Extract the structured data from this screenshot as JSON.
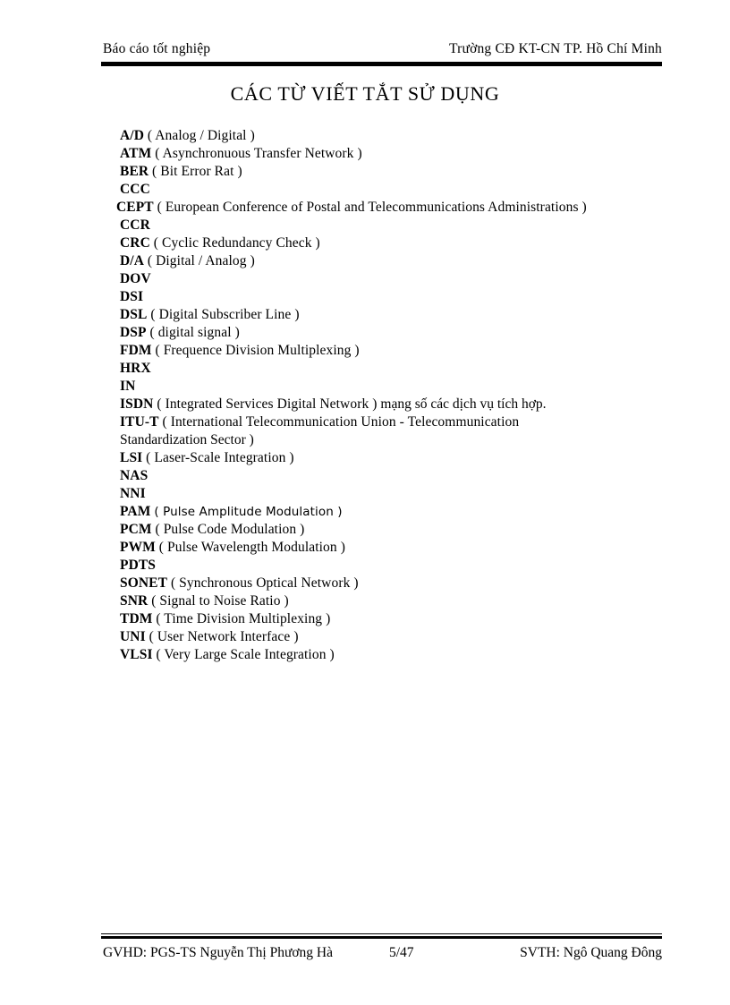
{
  "header": {
    "left": "Báo cáo tốt nghiệp",
    "right": "Trường CĐ KT-CN TP. Hồ Chí Minh"
  },
  "title": "CÁC TỪ VIẾT TẮT SỬ DỤNG",
  "abbreviations": [
    {
      "term": "A/D",
      "definition": "( Analog / Digital )"
    },
    {
      "term": "ATM",
      "definition": "( Asynchronuous  Transfer Network )"
    },
    {
      "term": "BER",
      "definition": "( Bit Error Rat )"
    },
    {
      "term": "CCC",
      "definition": ""
    },
    {
      "term": "CEPT",
      "definition": "( European  Conference of Postal and Telecommunications  Administrations  )"
    },
    {
      "term": "CCR",
      "definition": ""
    },
    {
      "term": "CRC",
      "definition": "( Cyclic Redundancy  Check )"
    },
    {
      "term": "D/A",
      "definition": "( Digital / Analog )"
    },
    {
      "term": "DOV",
      "definition": ""
    },
    {
      "term": "DSI",
      "definition": ""
    },
    {
      "term": "DSL",
      "definition": "( Digital Subscriber Line )"
    },
    {
      "term": "DSP",
      "definition": "( digital signal )"
    },
    {
      "term": "FDM",
      "definition": "( Frequence Division Multiplexing )"
    },
    {
      "term": "HRX",
      "definition": ""
    },
    {
      "term": "IN",
      "definition": ""
    },
    {
      "term": "ISDN",
      "definition": "( Integrated Services Digital Network )",
      "note": "mạng số các dịch vụ tích hợp."
    },
    {
      "term": "ITU-T",
      "definition": "( International Telecommunication Union - Telecommunication",
      "continuation": "Standardization  Sector )"
    },
    {
      "term": "LSI",
      "definition": "( Laser-Scale Integration )"
    },
    {
      "term": "NAS",
      "definition": ""
    },
    {
      "term": "NNI",
      "definition": ""
    },
    {
      "term": "PAM",
      "definition": "( Pulse Amplitude Modulation )",
      "alt_face": true
    },
    {
      "term": "PCM",
      "definition": "( Pulse Code Modulation )"
    },
    {
      "term": "PWM",
      "definition": "( Pulse Wavelength  Modulation )"
    },
    {
      "term": "PDTS",
      "definition": ""
    },
    {
      "term": "SONET",
      "definition": "( Synchronous  Optical Network )"
    },
    {
      "term": "SNR",
      "definition": "( Signal  to Noise Ratio )"
    },
    {
      "term": "TDM",
      "definition": "( Time Division Multiplexing )"
    },
    {
      "term": "UNI",
      "definition": "( User Network Interface )"
    },
    {
      "term": "VLSI",
      "definition": "( Very Large Scale Integration )"
    }
  ],
  "footer": {
    "advisor": "GVHD:  PGS-TS Nguyễn Thị Phương Hà",
    "page": "5/47",
    "student": "SVTH:  Ngô Quang Đông"
  }
}
